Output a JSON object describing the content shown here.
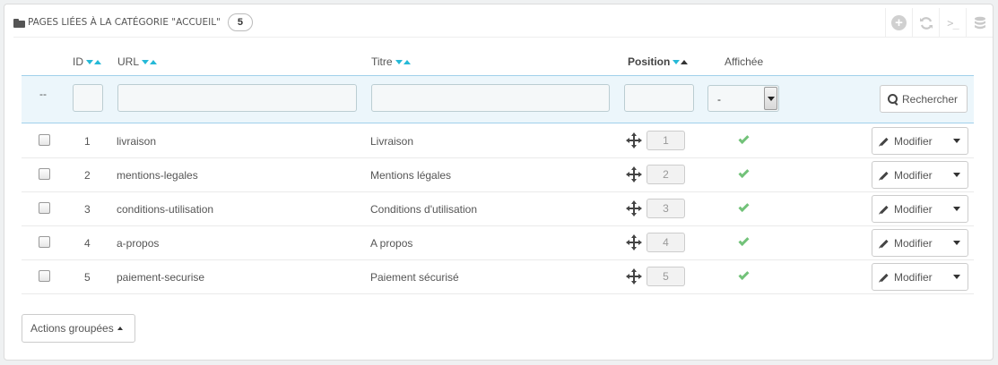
{
  "panel": {
    "title": "Pages liées à la catégorie \"Accueil\"",
    "count": "5",
    "toolbar": [
      "add-icon",
      "refresh-icon",
      "terminal-icon",
      "database-icon"
    ]
  },
  "table": {
    "headers": {
      "id": "ID",
      "url": "URL",
      "title": "Titre",
      "position": "Position",
      "displayed": "Affichée"
    },
    "filters": {
      "id_placeholder": "--",
      "displayed_selected": "-",
      "search_label": "Rechercher"
    },
    "rows": [
      {
        "id": "1",
        "url": "livraison",
        "title": "Livraison",
        "position": "1",
        "displayed": true,
        "action": "Modifier"
      },
      {
        "id": "2",
        "url": "mentions-legales",
        "title": "Mentions légales",
        "position": "2",
        "displayed": true,
        "action": "Modifier"
      },
      {
        "id": "3",
        "url": "conditions-utilisation",
        "title": "Conditions d'utilisation",
        "position": "3",
        "displayed": true,
        "action": "Modifier"
      },
      {
        "id": "4",
        "url": "a-propos",
        "title": "A propos",
        "position": "4",
        "displayed": true,
        "action": "Modifier"
      },
      {
        "id": "5",
        "url": "paiement-securise",
        "title": "Paiement sécurisé",
        "position": "5",
        "displayed": true,
        "action": "Modifier"
      }
    ]
  },
  "footer": {
    "bulk_actions_label": "Actions groupées"
  },
  "colors": {
    "accent": "#25b9d7",
    "check": "#72c279",
    "filter_bg": "#ecf6fb"
  }
}
